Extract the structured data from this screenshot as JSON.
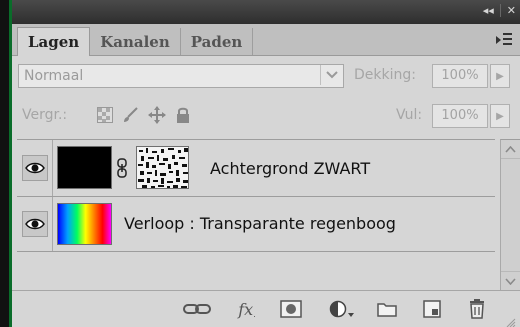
{
  "window": {
    "collapse_glyph": "◂◂",
    "close_glyph": "✕"
  },
  "tabs": [
    {
      "label": "Lagen",
      "active": true
    },
    {
      "label": "Kanalen",
      "active": false
    },
    {
      "label": "Paden",
      "active": false
    }
  ],
  "blend": {
    "mode": "Normaal",
    "opacity_label": "Dekking:",
    "opacity_value": "100%"
  },
  "lock": {
    "label": "Vergr.:",
    "icons": [
      "lock-transparency-icon",
      "lock-paint-icon",
      "lock-position-icon",
      "lock-all-icon"
    ],
    "fill_label": "Vul:",
    "fill_value": "100%"
  },
  "layers": [
    {
      "name": "Achtergrond ZWART",
      "visible": true,
      "thumbnail": "black-fill",
      "has_mask": true
    },
    {
      "name": "Verloop : Transparante regenboog",
      "visible": true,
      "thumbnail": "rainbow-gradient",
      "has_mask": false
    }
  ],
  "footer_icons": [
    "link-layers-icon",
    "layer-style-fx-icon",
    "add-mask-icon",
    "adjustment-layer-icon",
    "new-group-folder-icon",
    "new-layer-icon",
    "delete-layer-icon"
  ],
  "colors": {
    "panel_bg": "#d6d6d6",
    "tab_bar": "#bfbfbf",
    "titlebar": "#3a3a3a",
    "disabled_text": "#a6a6a6"
  }
}
